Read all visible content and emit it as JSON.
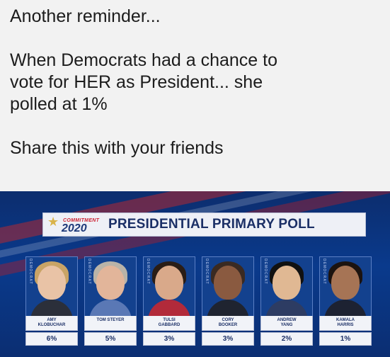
{
  "post": {
    "line1": "Another reminder...",
    "line2": "When Democrats had a chance to",
    "line3": "vote for HER as President... she",
    "line4": "polled at 1%",
    "line5": "Share this with your friends"
  },
  "graphic": {
    "logo_small": "COMMITMENT",
    "logo_year": "2020",
    "title": "PRESIDENTIAL PRIMARY POLL",
    "side_tag": "DEMOCRAT",
    "candidates": [
      {
        "name": "AMY\nKLOBUCHAR",
        "percent": "6%"
      },
      {
        "name": "TOM STEYER",
        "percent": "5%"
      },
      {
        "name": "TULSI\nGABBARD",
        "percent": "3%"
      },
      {
        "name": "CORY\nBOOKER",
        "percent": "3%"
      },
      {
        "name": "ANDREW\nYANG",
        "percent": "2%"
      },
      {
        "name": "KAMALA\nHARRIS",
        "percent": "1%"
      }
    ]
  }
}
